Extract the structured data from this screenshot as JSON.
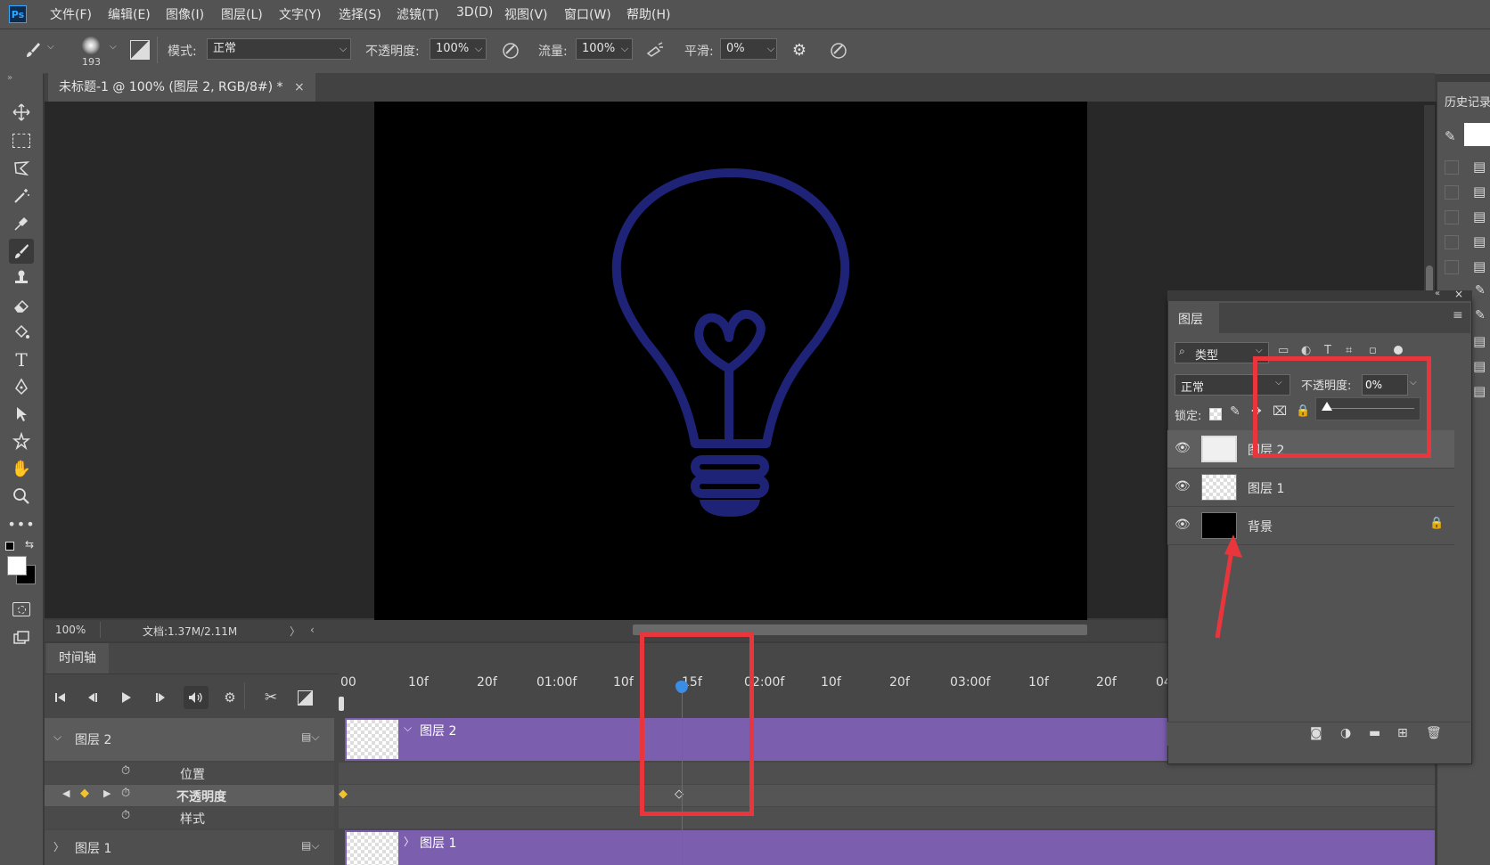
{
  "app": {
    "logo": "Ps"
  },
  "menu": [
    "文件(F)",
    "编辑(E)",
    "图像(I)",
    "图层(L)",
    "文字(Y)",
    "选择(S)",
    "滤镜(T)",
    "3D(D)",
    "视图(V)",
    "窗口(W)",
    "帮助(H)"
  ],
  "options": {
    "brush_size": "193",
    "mode_label": "模式:",
    "mode_value": "正常",
    "opacity_label": "不透明度:",
    "opacity_value": "100%",
    "flow_label": "流量:",
    "flow_value": "100%",
    "smooth_label": "平滑:",
    "smooth_value": "0%"
  },
  "document": {
    "tab_title": "未标题-1 @ 100% (图层 2, RGB/8#) *",
    "close_glyph": "×"
  },
  "status": {
    "zoom": "100%",
    "doc_info": "文档:1.37M/2.11M",
    "arrow": "〉",
    "left_arrow": "‹"
  },
  "timeline": {
    "tab_label": "时间轴",
    "ruler": [
      "00",
      "10f",
      "20f",
      "01:00f",
      "10f",
      "15f",
      "02:00f",
      "10f",
      "20f",
      "03:00f",
      "10f",
      "20f",
      "04"
    ],
    "layer2": {
      "name": "图层 2",
      "track_label": "图层 2"
    },
    "properties": [
      "位置",
      "不透明度",
      "样式"
    ],
    "layer1": {
      "name": "图层 1",
      "track_label": "图层 1"
    }
  },
  "history": {
    "title": "历史记录"
  },
  "layers_panel": {
    "title": "图层",
    "filter_label": "类型",
    "blend_mode": "正常",
    "opacity_label": "不透明度:",
    "opacity_value": "0%",
    "lock_label": "锁定:",
    "layers": [
      {
        "name": "图层 2"
      },
      {
        "name": "图层 1"
      },
      {
        "name": "背景"
      }
    ]
  },
  "colors": {
    "accent_red": "#e8363c",
    "track_purple": "#7b5fae",
    "bulb_blue": "#1f2378",
    "playhead": "#3a8ee6"
  }
}
